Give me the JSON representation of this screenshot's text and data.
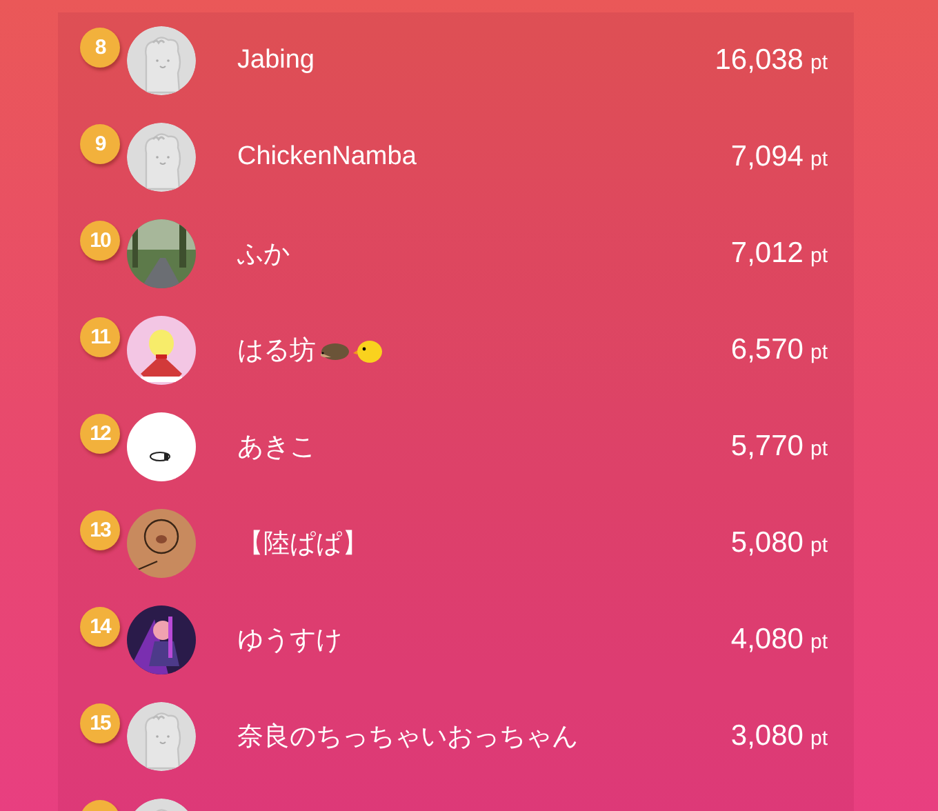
{
  "ranking": [
    {
      "kind": "full",
      "rank": "8",
      "avatar": {
        "kind": "default"
      },
      "name": "Jabing",
      "points": "16,038",
      "unit": "pt"
    },
    {
      "kind": "full",
      "rank": "9",
      "avatar": {
        "kind": "default"
      },
      "name": "ChickenNamba",
      "points": "7,094",
      "unit": "pt"
    },
    {
      "kind": "full",
      "rank": "10",
      "name": "ふか",
      "points": "7,012",
      "unit": "pt"
    },
    {
      "kind": "full",
      "rank": "11",
      "name": "はる坊",
      "name_emoji": [
        {
          "kind": "hedgehog"
        },
        {
          "kind": "chick"
        }
      ],
      "points": "6,570",
      "unit": "pt"
    },
    {
      "kind": "full",
      "rank": "12",
      "name": "あきこ",
      "points": "5,770",
      "unit": "pt"
    },
    {
      "kind": "full",
      "rank": "13",
      "name": "【陸ぱぱ】",
      "points": "5,080",
      "unit": "pt"
    },
    {
      "kind": "full",
      "rank": "14",
      "name": "ゆうすけ",
      "points": "4,080",
      "unit": "pt"
    },
    {
      "kind": "full",
      "rank": "15",
      "avatar": {
        "kind": "default"
      },
      "name": "奈良のちっちゃいおっちゃん",
      "points": "3,080",
      "unit": "pt"
    },
    {
      "kind": "cut",
      "avatar": {
        "kind": "default"
      }
    }
  ]
}
